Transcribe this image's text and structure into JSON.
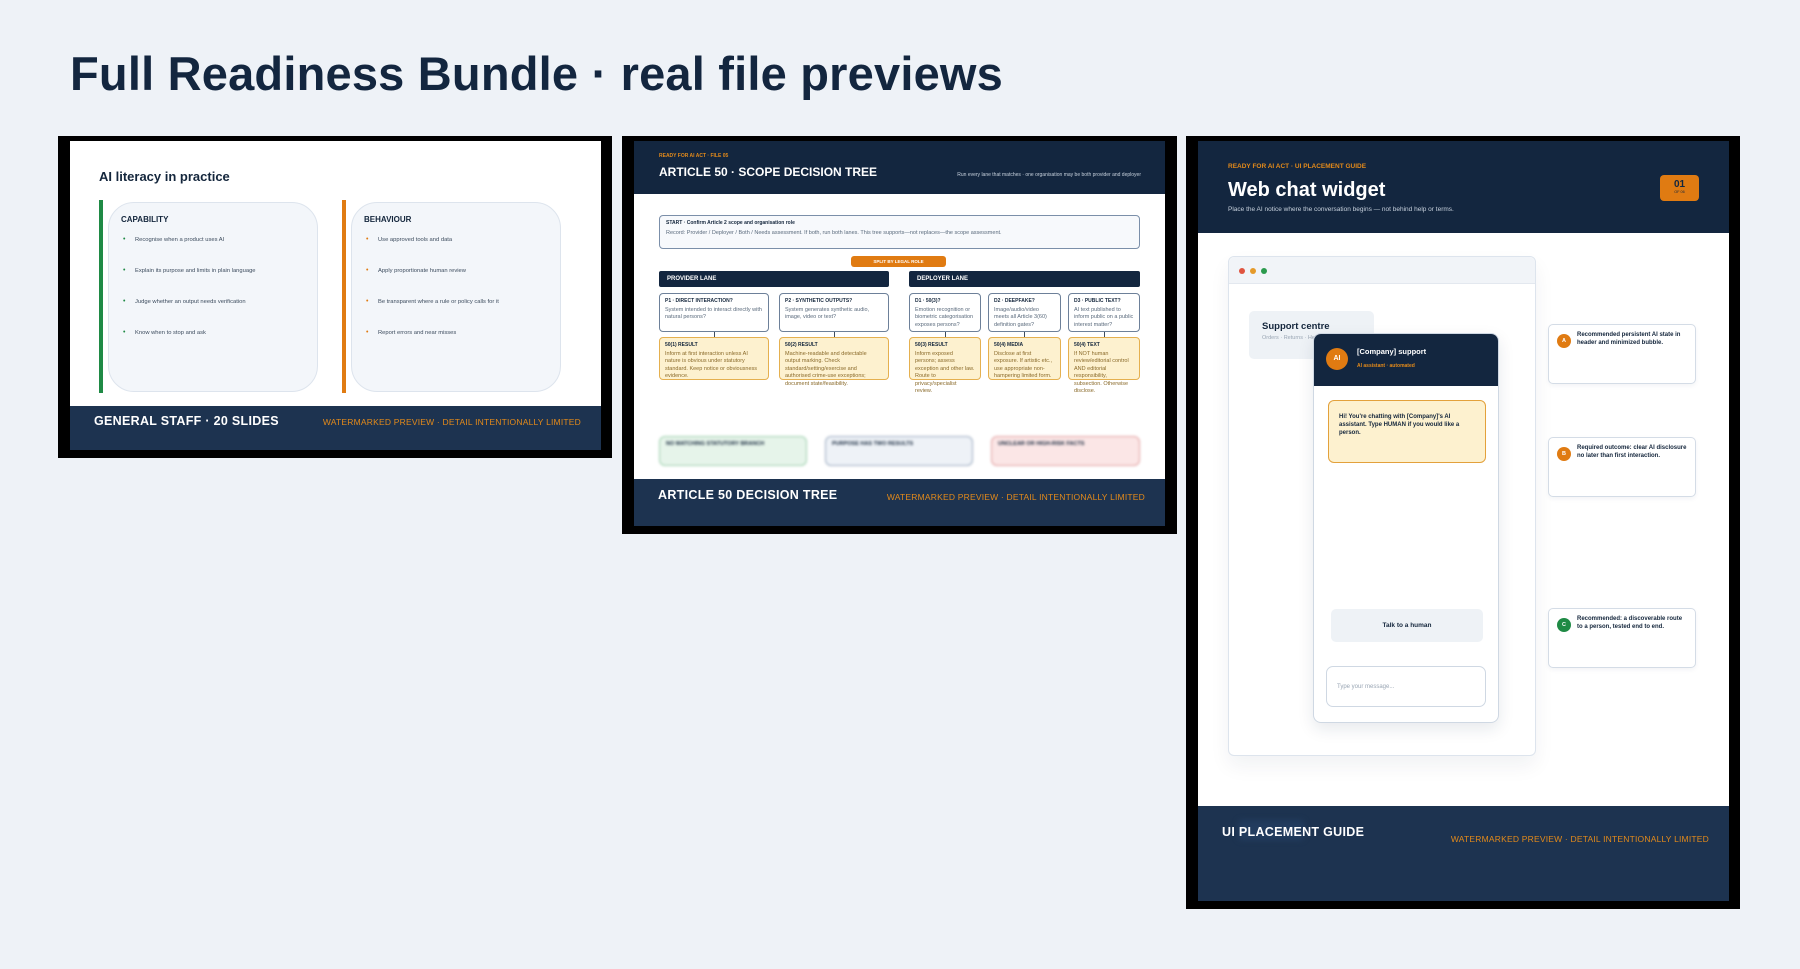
{
  "page": {
    "title": "Full Readiness Bundle · real file previews"
  },
  "card1": {
    "slide_title": "AI literacy in practice",
    "columns": [
      {
        "heading": "CAPABILITY",
        "bar_color": "#1f8a45",
        "items": [
          "Recognise when a product uses AI",
          "Explain its purpose and limits in plain language",
          "Judge whether an output needs verification",
          "Know when to stop and ask"
        ]
      },
      {
        "heading": "BEHAVIOUR",
        "bar_color": "#e07b12",
        "items": [
          "Use approved tools and data",
          "Apply proportionate human review",
          "Be transparent where a rule or policy calls for it",
          "Report errors and near misses"
        ]
      }
    ],
    "footer_title": "GENERAL STAFF · 20 SLIDES",
    "footer_note": "WATERMARKED PREVIEW · DETAIL INTENTIONALLY LIMITED"
  },
  "card2": {
    "kicker": "READY FOR AI ACT · FILE 05",
    "title": "ARTICLE 50 · SCOPE DECISION TREE",
    "subtitle": "Run every lane that matches · one organisation may be both provider and deployer",
    "start_title": "START · Confirm Article 2 scope and organisation role",
    "start_text": "Record: Provider / Deployer / Both / Needs assessment. If both, run both lanes. This tree supports—not replaces—the scope assessment.",
    "split_label": "SPLIT BY LEGAL ROLE",
    "lanes": [
      "PROVIDER LANE",
      "DEPLOYER LANE"
    ],
    "questions": [
      {
        "title": "P1 · DIRECT INTERACTION?",
        "text": "System intended to interact directly with natural persons?"
      },
      {
        "title": "P2 · SYNTHETIC OUTPUTS?",
        "text": "System generates synthetic audio, image, video or text?"
      },
      {
        "title": "D1 · 50(3)?",
        "text": "Emotion recognition or biometric categorisation exposes persons?"
      },
      {
        "title": "D2 · DEEPFAKE?",
        "text": "Image/audio/video meets all Article 3(60) definition gates?"
      },
      {
        "title": "D3 · PUBLIC TEXT?",
        "text": "AI text published to inform public on a public interest matter?"
      }
    ],
    "results": [
      {
        "title": "50(1) RESULT",
        "text": "Inform at first interaction unless AI nature is obvious under statutory standard. Keep notice or obviousness evidence."
      },
      {
        "title": "50(2) RESULT",
        "text": "Machine-readable and detectable output marking. Check standard/setting/exercise and authorised crime-use exceptions; document state/feasibility."
      },
      {
        "title": "50(3) RESULT",
        "text": "Inform exposed persons; assess exception and other law. Route to privacy/specialist review."
      },
      {
        "title": "50(4) MEDIA",
        "text": "Disclose at first exposure. If artistic etc., use appropriate non-hampering limited form."
      },
      {
        "title": "50(4) TEXT",
        "text": "If NOT human review/editorial control AND editorial responsibility, subsection. Otherwise disclose."
      }
    ],
    "bottom_rows": [
      "NO MATCHING STATUTORY BRANCH",
      "PURPOSE HAS TWO RESULTS",
      "UNCLEAR OR HIGH-RISK FACTS"
    ],
    "footer_title": "ARTICLE 50 DECISION TREE",
    "footer_note": "WATERMARKED PREVIEW · DETAIL INTENTIONALLY LIMITED"
  },
  "card3": {
    "kicker": "READY FOR AI ACT · UI PLACEMENT GUIDE",
    "title": "Web chat widget",
    "subtitle": "Place the AI notice where the conversation begins — not behind help or terms.",
    "badge_number": "01",
    "badge_sub": "OF 06",
    "support_title": "Support centre",
    "support_links": "Orders · Returns · Help",
    "widget": {
      "avatar": "AI",
      "name": "[Company] support",
      "status": "AI assistant · automated",
      "message": "Hi! You're chatting with [Company]'s AI assistant. Type HUMAN if you would like a person.",
      "human_button": "Talk to a human",
      "input_placeholder": "Type your message..."
    },
    "notes": [
      {
        "badge": "A",
        "color": "#e07b12",
        "text": "Recommended persistent AI state in header and minimized bubble."
      },
      {
        "badge": "B",
        "color": "#e07b12",
        "text": "Required outcome: clear AI disclosure no later than first interaction."
      },
      {
        "badge": "C",
        "color": "#1f8a45",
        "text": "Recommended: a discoverable route to a person, tested end to end."
      }
    ],
    "footer_title": "UI PLACEMENT GUIDE",
    "footer_note": "WATERMARKED PREVIEW · DETAIL INTENTIONALLY LIMITED"
  },
  "colors": {
    "navy": "#13263f",
    "orange": "#e07b12",
    "green": "#1f8a45",
    "background": "#eef2f7"
  }
}
